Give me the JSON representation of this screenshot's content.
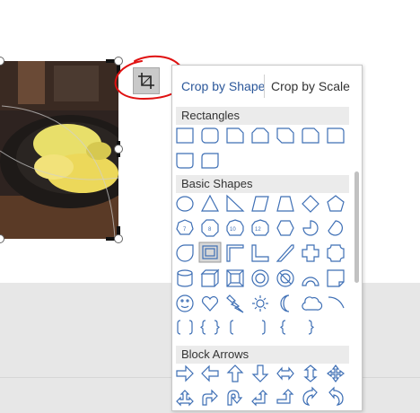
{
  "crop_menu": {
    "tab_crop_by_shape": "Crop by Shape",
    "tab_crop_by_scale": "Crop by Scale",
    "active_tab": "Crop by Shape",
    "sections": [
      {
        "title": "Rectangles"
      },
      {
        "title": "Basic Shapes"
      },
      {
        "title": "Block Arrows"
      }
    ]
  },
  "toolbar": {
    "crop_icon": "crop-icon"
  },
  "colors": {
    "accent": "#2b579a",
    "shape_stroke": "#3e6fb5",
    "annotation": "#e01010",
    "section_bg": "#ebebeb"
  }
}
